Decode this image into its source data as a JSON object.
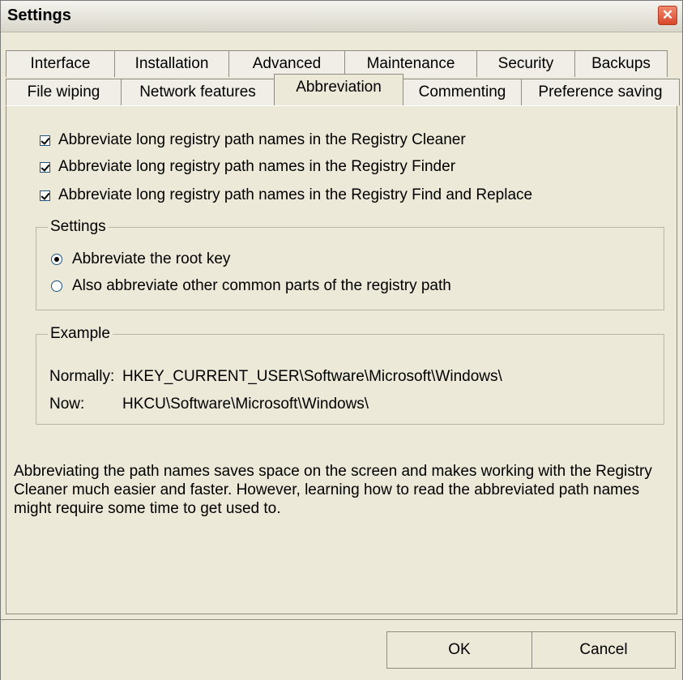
{
  "window": {
    "title": "Settings",
    "close_glyph": "✕"
  },
  "tabs": {
    "row1": [
      "Interface",
      "Installation",
      "Advanced",
      "Maintenance",
      "Security",
      "Backups"
    ],
    "row2": [
      "File wiping",
      "Network features",
      "Abbreviation",
      "Commenting",
      "Preference saving"
    ],
    "active": "Abbreviation"
  },
  "checkboxes": [
    {
      "label": "Abbreviate long registry path names in the Registry Cleaner",
      "checked": true
    },
    {
      "label": "Abbreviate long registry path names in the Registry Finder",
      "checked": true
    },
    {
      "label": "Abbreviate long registry path names in the Registry Find and Replace",
      "checked": true
    }
  ],
  "settings_group": {
    "label": "Settings",
    "options": [
      {
        "label": "Abbreviate the root key",
        "selected": true
      },
      {
        "label": "Also abbreviate other common parts of the registry path",
        "selected": false
      }
    ]
  },
  "example_group": {
    "label": "Example",
    "normally_label": "Normally:",
    "normally_value": "HKEY_CURRENT_USER\\Software\\Microsoft\\Windows\\",
    "now_label": "Now:",
    "now_value": "HKCU\\Software\\Microsoft\\Windows\\"
  },
  "description": "Abbreviating the path names saves space on the screen and makes working with the Registry Cleaner much easier and faster. However, learning how to read the abbreviated path names might require some time to get used to.",
  "buttons": {
    "ok": "OK",
    "cancel": "Cancel"
  }
}
